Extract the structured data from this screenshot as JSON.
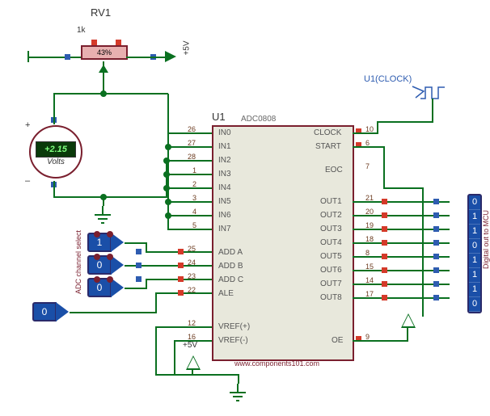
{
  "pot": {
    "ref": "RV1",
    "value": "1k",
    "setting": "43%"
  },
  "voltmeter": {
    "reading": "+2.15",
    "unit": "Volts"
  },
  "supply5v": "+5V",
  "chip": {
    "ref": "U1",
    "part": "ADC0808",
    "left_pins": [
      {
        "num": "26",
        "name": "IN0"
      },
      {
        "num": "27",
        "name": "IN1"
      },
      {
        "num": "28",
        "name": "IN2"
      },
      {
        "num": "1",
        "name": "IN3"
      },
      {
        "num": "2",
        "name": "IN4"
      },
      {
        "num": "3",
        "name": "IN5"
      },
      {
        "num": "4",
        "name": "IN6"
      },
      {
        "num": "5",
        "name": "IN7"
      },
      {
        "num": "25",
        "name": "ADD A"
      },
      {
        "num": "24",
        "name": "ADD B"
      },
      {
        "num": "23",
        "name": "ADD C"
      },
      {
        "num": "22",
        "name": "ALE"
      },
      {
        "num": "12",
        "name": "VREF(+)"
      },
      {
        "num": "16",
        "name": "VREF(-)"
      }
    ],
    "right_pins": [
      {
        "num": "10",
        "name": "CLOCK"
      },
      {
        "num": "6",
        "name": "START"
      },
      {
        "num": "7",
        "name": "EOC"
      },
      {
        "num": "21",
        "name": "OUT1"
      },
      {
        "num": "20",
        "name": "OUT2"
      },
      {
        "num": "19",
        "name": "OUT3"
      },
      {
        "num": "18",
        "name": "OUT4"
      },
      {
        "num": "8",
        "name": "OUT5"
      },
      {
        "num": "15",
        "name": "OUT6"
      },
      {
        "num": "14",
        "name": "OUT7"
      },
      {
        "num": "17",
        "name": "OUT8"
      },
      {
        "num": "9",
        "name": "OE"
      }
    ],
    "footer": "www.components101.com"
  },
  "clock_gen": "U1(CLOCK)",
  "adc_select_label": "ADC channel select",
  "adc_select": [
    "1",
    "0",
    "0"
  ],
  "ale_input": "0",
  "digital_out_label": "Digital out to MCU",
  "digital_out": [
    "0",
    "1",
    "1",
    "0",
    "1",
    "1",
    "1",
    "0"
  ]
}
